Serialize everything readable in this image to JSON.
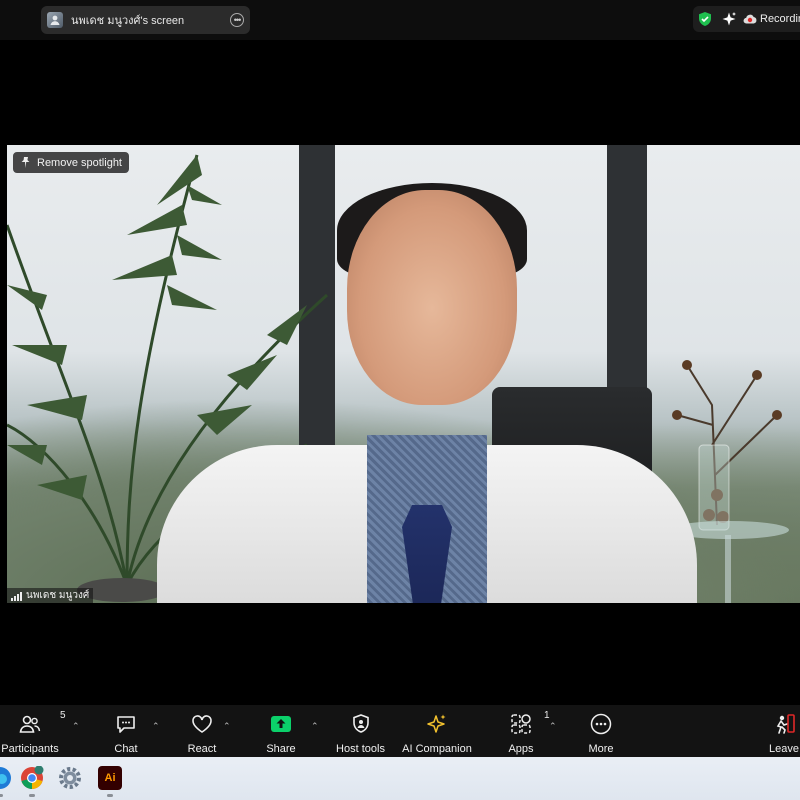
{
  "topbar": {
    "share_label": "นพเดช มนูวงศ์'s screen",
    "more_icon": "ellipsis-icon",
    "recording_label": "Recording",
    "icons": [
      "shield-check-icon",
      "sparkle-icon",
      "cloud-record-icon"
    ]
  },
  "video": {
    "spotlight_label": "Remove spotlight",
    "participant_name": "นพเดช มนูวงศ์"
  },
  "toolbar": {
    "participants": {
      "label": "Participants",
      "count": "5"
    },
    "chat": {
      "label": "Chat"
    },
    "react": {
      "label": "React"
    },
    "share": {
      "label": "Share"
    },
    "host_tools": {
      "label": "Host tools"
    },
    "ai_companion": {
      "label": "AI Companion"
    },
    "apps": {
      "label": "Apps",
      "count": "1"
    },
    "more": {
      "label": "More"
    },
    "leave": {
      "label": "Leave"
    }
  },
  "taskbar": {
    "apps": [
      "edge-icon",
      "chrome-icon",
      "settings-icon",
      "illustrator-icon"
    ],
    "illustrator_text": "Ai"
  },
  "colors": {
    "toolbar_bg": "#131313",
    "share_green": "#0bd06a",
    "shield_green": "#1fbf4f",
    "leave_red": "#e02828",
    "taskbar_bg": "#e5ebf3"
  }
}
